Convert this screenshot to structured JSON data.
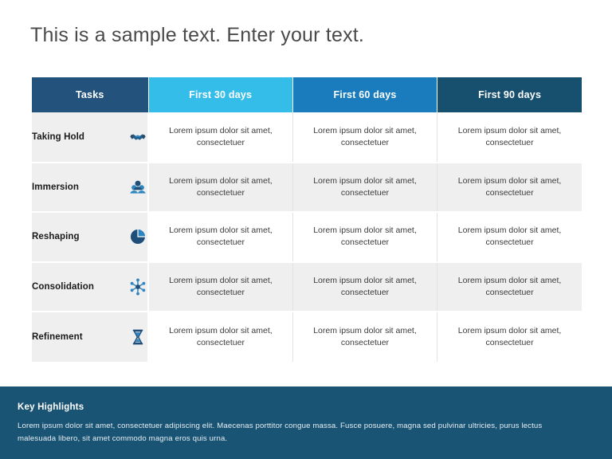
{
  "slide": {
    "title": "This is a sample text. Enter your text."
  },
  "colors": {
    "tasks_header": "#23527c",
    "days30_header": "#35bdea",
    "days60_header": "#1a7cbd",
    "days90_header": "#17506f",
    "footer_banner": "#1a5474",
    "row_gray": "#efefef",
    "row_white": "#ffffff",
    "icon_blue": "#1f6ea8",
    "title_text": "#4a4a4a"
  },
  "table": {
    "headers": [
      {
        "label": "Tasks",
        "style": "hdr-tasks"
      },
      {
        "label": "First 30 days",
        "style": "hdr-d30"
      },
      {
        "label": "First 60 days",
        "style": "hdr-d60"
      },
      {
        "label": "First 90 days",
        "style": "hdr-d90"
      }
    ],
    "cell_text": "Lorem ipsum dolor sit amet, consectetuer",
    "rows": [
      {
        "task": "Taking Hold",
        "icon": "handshake-icon",
        "shade": "row-white",
        "cells": [
          "Lorem ipsum dolor sit amet, consectetuer",
          "Lorem ipsum dolor sit amet, consectetuer",
          "Lorem ipsum dolor sit amet, consectetuer"
        ]
      },
      {
        "task": "Immersion",
        "icon": "people-group-icon",
        "shade": "row-gray",
        "cells": [
          "Lorem ipsum dolor sit amet, consectetuer",
          "Lorem ipsum dolor sit amet, consectetuer",
          "Lorem ipsum dolor sit amet, consectetuer"
        ]
      },
      {
        "task": "Reshaping",
        "icon": "pie-chart-icon",
        "shade": "row-white",
        "cells": [
          "Lorem ipsum dolor sit amet, consectetuer",
          "Lorem ipsum dolor sit amet, consectetuer",
          "Lorem ipsum dolor sit amet, consectetuer"
        ]
      },
      {
        "task": "Consolidation",
        "icon": "network-nodes-icon",
        "shade": "row-gray",
        "cells": [
          "Lorem ipsum dolor sit amet, consectetuer",
          "Lorem ipsum dolor sit amet, consectetuer",
          "Lorem ipsum dolor sit amet, consectetuer"
        ]
      },
      {
        "task": "Refinement",
        "icon": "hourglass-icon",
        "shade": "row-white",
        "cells": [
          "Lorem ipsum dolor sit amet, consectetuer",
          "Lorem ipsum dolor sit amet, consectetuer",
          "Lorem ipsum dolor sit amet, consectetuer"
        ]
      }
    ]
  },
  "footer": {
    "title": "Key Highlights",
    "body": "Lorem ipsum dolor sit amet, consectetuer adipiscing elit. Maecenas porttitor congue massa. Fusce posuere, magna sed pulvinar ultricies, purus lectus malesuada libero, sit amet commodo magna eros quis urna."
  }
}
